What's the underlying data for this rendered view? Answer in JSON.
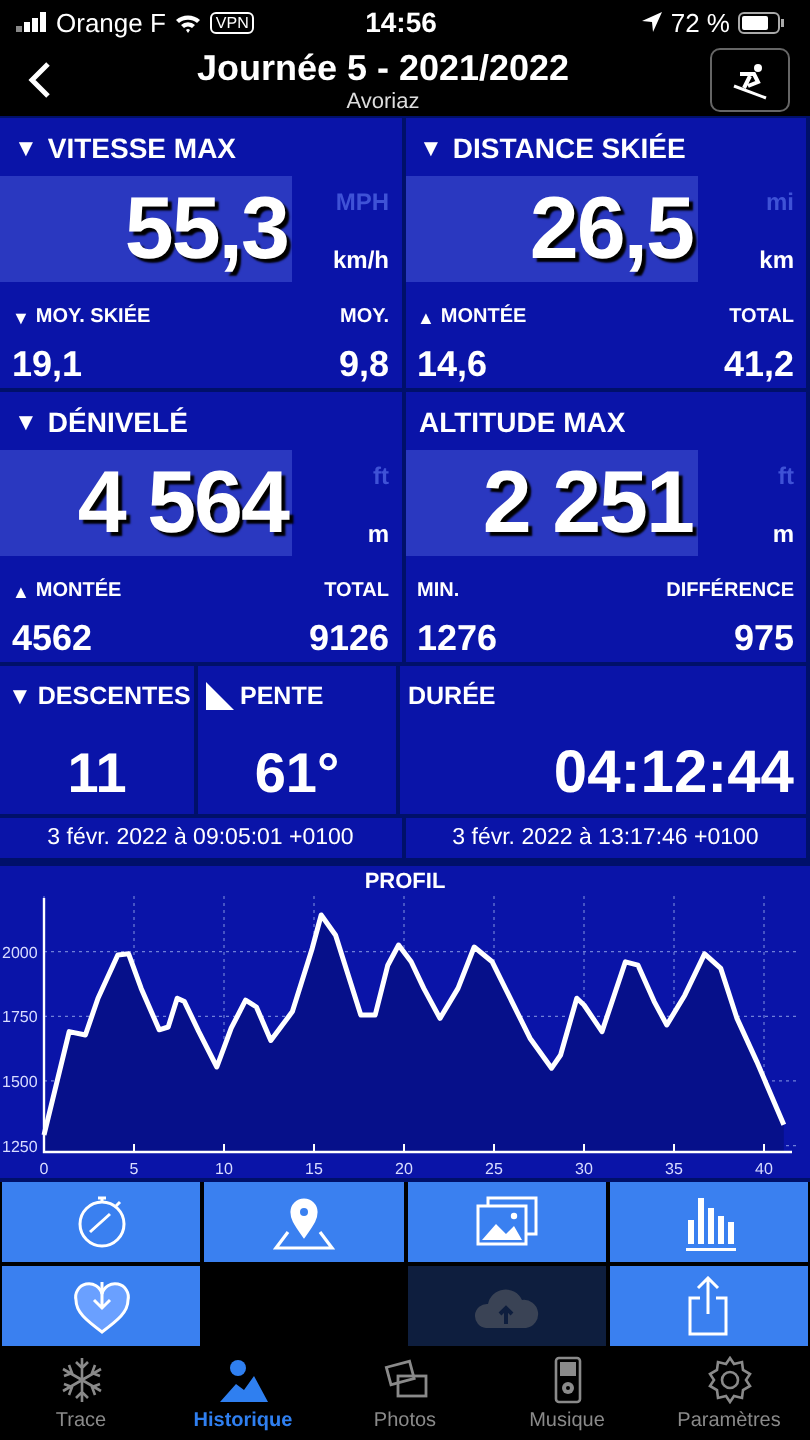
{
  "status_bar": {
    "carrier": "Orange F",
    "vpn": "VPN",
    "time": "14:56",
    "battery": "72 %"
  },
  "header": {
    "title": "Journée 5 - 2021/2022",
    "subtitle": "Avoriaz"
  },
  "big_panels": [
    {
      "marker": "▼",
      "title": "VITESSE MAX",
      "value": "55,3",
      "unit_alt": "MPH",
      "unit": "km/h",
      "left_marker": "▼",
      "left_label": "MOY. SKIÉE",
      "right_label": "MOY.",
      "left_value": "19,1",
      "right_value": "9,8"
    },
    {
      "marker": "▼",
      "title": "DISTANCE SKIÉE",
      "value": "26,5",
      "unit_alt": "mi",
      "unit": "km",
      "left_marker": "▲",
      "left_label": "MONTÉE",
      "right_label": "TOTAL",
      "left_value": "14,6",
      "right_value": "41,2"
    },
    {
      "marker": "▼",
      "title": "DÉNIVELÉ",
      "value": "4 564",
      "unit_alt": "ft",
      "unit": "m",
      "left_marker": "▲",
      "left_label": "MONTÉE",
      "right_label": "TOTAL",
      "left_value": "4562",
      "right_value": "9126"
    },
    {
      "title": "ALTITUDE MAX",
      "value": "2 251",
      "unit_alt": "ft",
      "unit": "m",
      "left_label": "MIN.",
      "right_label": "DIFFÉRENCE",
      "left_value": "1276",
      "right_value": "975"
    }
  ],
  "small_panels": [
    {
      "kind": "marker",
      "marker": "▼",
      "title": "DESCENTES",
      "value": "11"
    },
    {
      "kind": "slope",
      "title": "PENTE",
      "value": "61°"
    },
    {
      "kind": "wide",
      "title": "DURÉE",
      "value": "04:12:44"
    }
  ],
  "dates": [
    "3 févr. 2022 à 09:05:01 +0100",
    "3 févr. 2022 à 13:17:46 +0100"
  ],
  "profile": {
    "chart_data": {
      "type": "area",
      "title": "PROFIL",
      "grid": true,
      "xlim": [
        0,
        41.5
      ],
      "ylim": [
        1225,
        2200
      ],
      "xticks": [
        0,
        5,
        10,
        15,
        20,
        25,
        30,
        35,
        40
      ],
      "yticks": [
        1250,
        1500,
        1750,
        2000
      ],
      "x": [
        0,
        1.4,
        2.3,
        3,
        4.1,
        4.7,
        5.4,
        6.4,
        6.9,
        7.4,
        7.8,
        8.6,
        9.6,
        10.4,
        11.2,
        11.8,
        12.6,
        13.8,
        14.9,
        15.4,
        16.2,
        17.6,
        18.4,
        19.1,
        19.7,
        20.4,
        21.1,
        22,
        23,
        23.9,
        24.9,
        25.9,
        27,
        28.2,
        28.7,
        29.6,
        30,
        31,
        32.3,
        33,
        33.9,
        34.6,
        35.6,
        36.7,
        37.6,
        38.5,
        39.6,
        41.1
      ],
      "series": [
        {
          "color": "#ffffff",
          "values": [
            1291,
            1691,
            1678,
            1820,
            1987,
            1992,
            1858,
            1698,
            1709,
            1820,
            1807,
            1691,
            1554,
            1704,
            1812,
            1786,
            1657,
            1768,
            2013,
            2142,
            2064,
            1755,
            1755,
            1948,
            2026,
            1961,
            1858,
            1742,
            1858,
            2018,
            1961,
            1820,
            1665,
            1549,
            1600,
            1820,
            1794,
            1691,
            1961,
            1948,
            1807,
            1716,
            1832,
            1992,
            1935,
            1742,
            1575,
            1330
          ]
        }
      ]
    }
  },
  "actions": [
    {
      "kind": "stopwatch",
      "disabled": false
    },
    {
      "kind": "map",
      "disabled": false
    },
    {
      "kind": "photos",
      "disabled": false
    },
    {
      "kind": "bars",
      "disabled": false
    },
    {
      "kind": "heart",
      "disabled": false
    },
    {
      "kind": "cloud",
      "disabled": true
    },
    {
      "kind": "share",
      "disabled": false
    }
  ],
  "tabs": [
    {
      "kind": "snow",
      "label": "Trace",
      "selected": false
    },
    {
      "kind": "history",
      "label": "Historique",
      "selected": true
    },
    {
      "kind": "photos",
      "label": "Photos",
      "selected": false
    },
    {
      "kind": "music",
      "label": "Musique",
      "selected": false
    },
    {
      "kind": "settings",
      "label": "Paramètres",
      "selected": false
    }
  ]
}
